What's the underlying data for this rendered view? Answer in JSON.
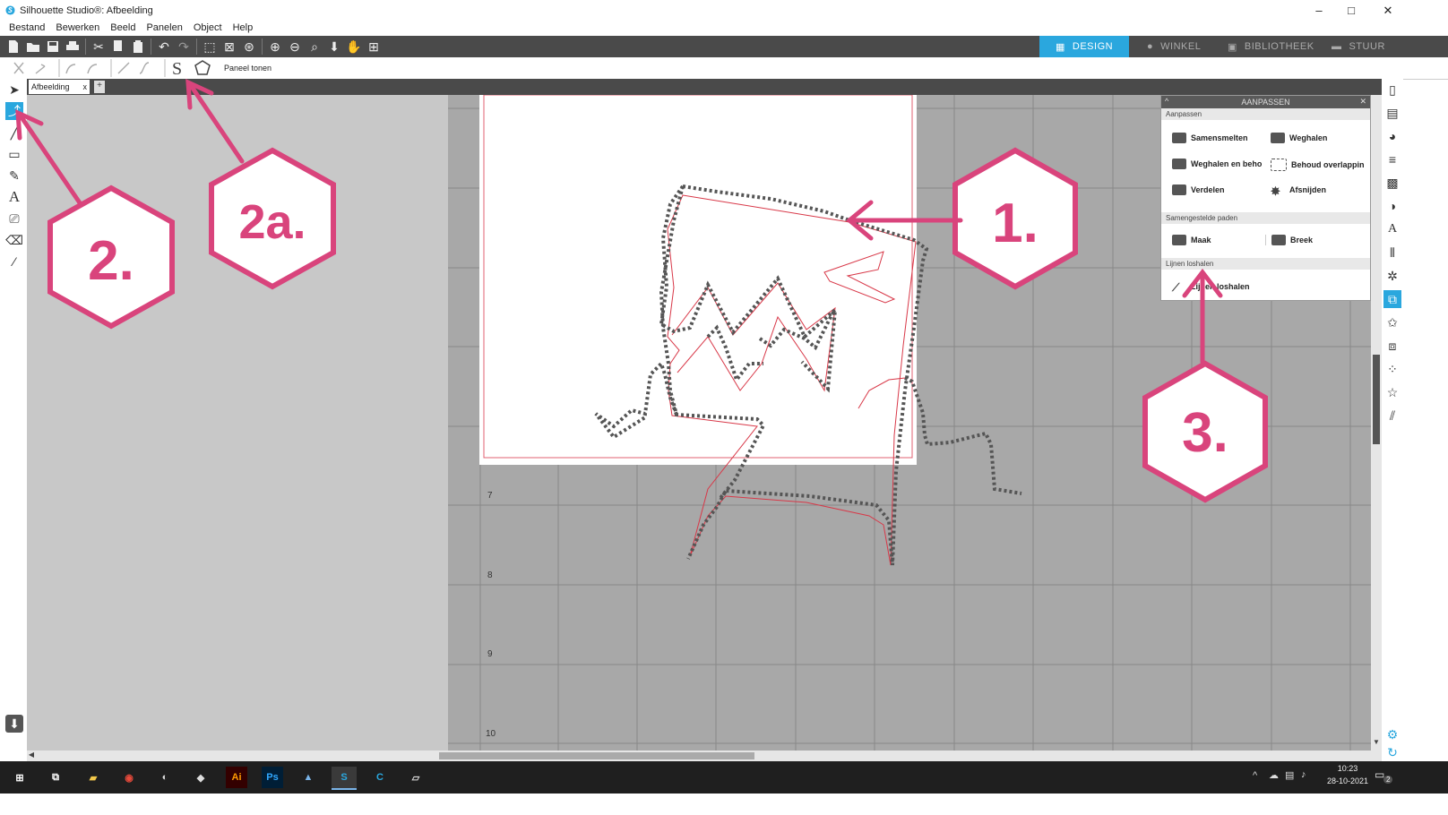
{
  "window": {
    "title": "Silhouette Studio®: Afbeelding",
    "controls": [
      "–",
      "□",
      "✕"
    ]
  },
  "menu": [
    "Bestand",
    "Bewerken",
    "Beeld",
    "Panelen",
    "Object",
    "Help"
  ],
  "nav_tabs": [
    {
      "label": "DESIGN",
      "active": true
    },
    {
      "label": "WINKEL",
      "active": false
    },
    {
      "label": "BIBLIOTHEEK",
      "active": false
    },
    {
      "label": "STUUR",
      "active": false
    }
  ],
  "subtoolbar": {
    "show_panel_label": "Paneel tonen"
  },
  "doc_tab": {
    "label": "Afbeelding",
    "close": "x",
    "add": "+"
  },
  "ruler_labels": [
    "7",
    "8",
    "9",
    "10"
  ],
  "panel": {
    "title": "AANPASSEN",
    "sections": [
      {
        "header": "Aanpassen",
        "items": [
          "Samensmelten",
          "Weghalen",
          "Weghalen en beho",
          "Behoud overlappin",
          "Verdelen",
          "Afsnijden"
        ]
      },
      {
        "header": "Samengestelde paden",
        "items": [
          "Maak",
          "Breek"
        ]
      },
      {
        "header": "Lijnen loshalen",
        "items": [
          "Lijnen loshalen"
        ]
      }
    ]
  },
  "annotations": [
    "1.",
    "2.",
    "2a.",
    "3."
  ],
  "taskbar": {
    "apps": [
      "Ai",
      "Ps"
    ],
    "time": "10:23",
    "date": "28-10-2021",
    "notifications": "2"
  },
  "colors": {
    "accent_blue": "#2aa7de",
    "annotation_pink": "#d9447c",
    "toolbar_dark": "#4a4a4a"
  }
}
